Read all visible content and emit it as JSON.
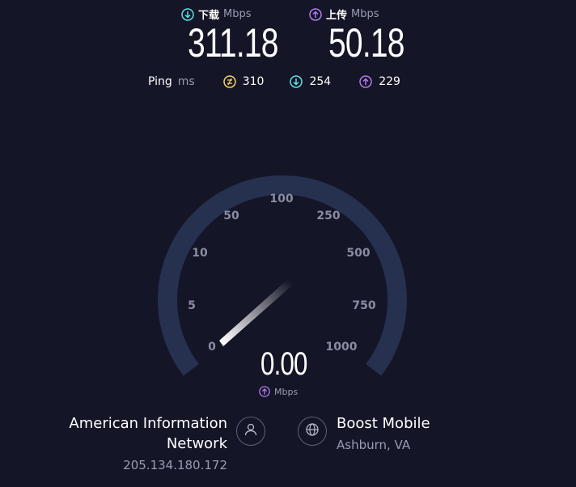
{
  "download": {
    "label": "下载",
    "unit": "Mbps",
    "value": "311.18"
  },
  "upload": {
    "label": "上传",
    "unit": "Mbps",
    "value": "50.18"
  },
  "ping": {
    "label": "Ping",
    "unit": "ms",
    "idle": "310",
    "down": "254",
    "up": "229"
  },
  "gauge": {
    "ticks": [
      "0",
      "5",
      "10",
      "50",
      "100",
      "250",
      "500",
      "750",
      "1000"
    ],
    "value": "0.00",
    "unit": "Mbps",
    "track_color": "#26304f"
  },
  "provider": {
    "name_line1": "American Information",
    "name_line2": "Network",
    "ip": "205.134.180.172"
  },
  "server": {
    "name": "Boost Mobile",
    "location": "Ashburn, VA"
  },
  "colors": {
    "download_accent": "#5ee0e6",
    "upload_accent": "#b07cf0",
    "ping_accent": "#f3d36b"
  }
}
